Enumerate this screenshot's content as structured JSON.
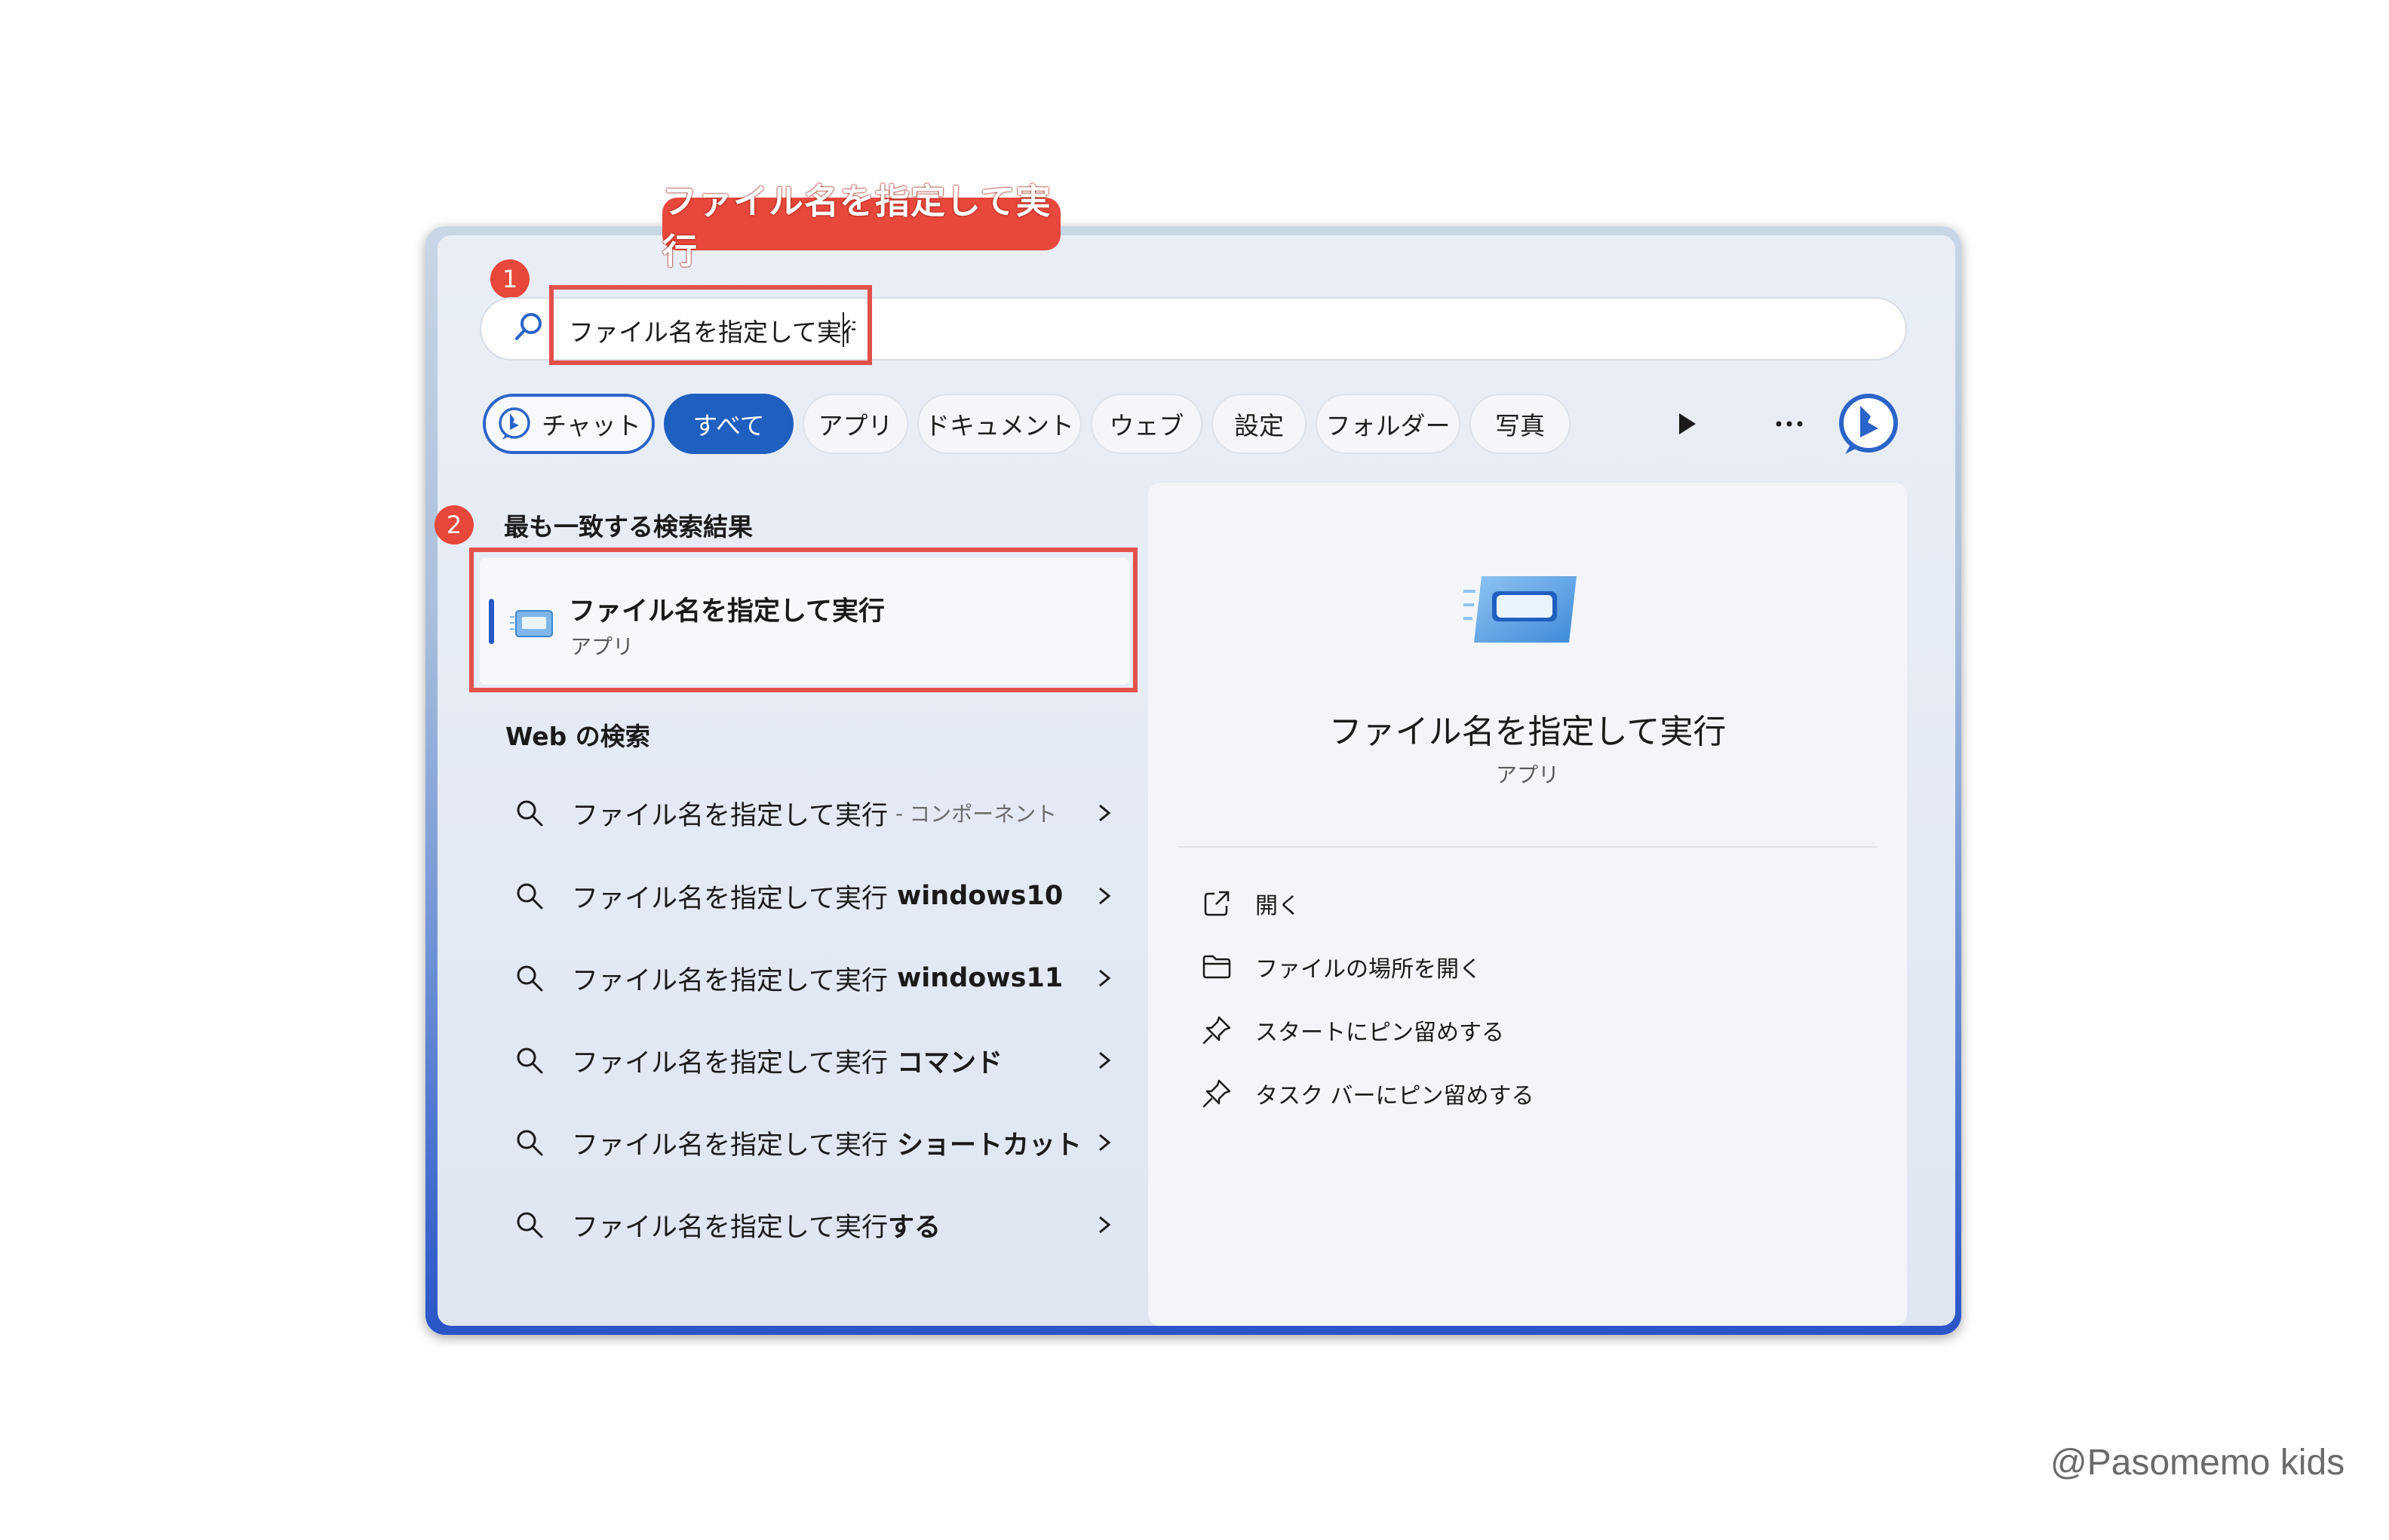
{
  "annotation": {
    "title": "ファイル名を指定して実行",
    "step1": "1",
    "step2": "2"
  },
  "search": {
    "query": "ファイル名を指定して実行"
  },
  "filters": [
    {
      "label": "チャット",
      "icon": "bing-chat-icon"
    },
    {
      "label": "すべて",
      "active": true
    },
    {
      "label": "アプリ"
    },
    {
      "label": "ドキュメント"
    },
    {
      "label": "ウェブ"
    },
    {
      "label": "設定"
    },
    {
      "label": "フォルダー"
    },
    {
      "label": "写真"
    }
  ],
  "toolbar_icons": [
    "play-more-icon",
    "more-options-icon",
    "bing-icon"
  ],
  "best_match": {
    "heading": "最も一致する検索結果",
    "title": "ファイル名を指定して実行",
    "subtitle": "アプリ"
  },
  "web_search": {
    "heading": "Web の検索",
    "items": [
      {
        "query": "ファイル名を指定して実行",
        "separator": "-",
        "suffix": "コンポーネント",
        "suffix_style": "light"
      },
      {
        "query": "ファイル名を指定して実行",
        "suffix": "windows10",
        "suffix_style": "bold"
      },
      {
        "query": "ファイル名を指定して実行",
        "suffix": "windows11",
        "suffix_style": "bold"
      },
      {
        "query": "ファイル名を指定して実行",
        "suffix": "コマンド",
        "suffix_style": "bold"
      },
      {
        "query": "ファイル名を指定して実行",
        "suffix": "ショートカット",
        "suffix_style": "bold"
      },
      {
        "query": "ファイル名を指定して実行",
        "suffix": "する",
        "suffix_style": "bold"
      }
    ]
  },
  "detail": {
    "title": "ファイル名を指定して実行",
    "subtitle": "アプリ",
    "actions": [
      {
        "label": "開く",
        "icon": "open-external-icon"
      },
      {
        "label": "ファイルの場所を開く",
        "icon": "folder-icon"
      },
      {
        "label": "スタートにピン留めする",
        "icon": "pin-icon"
      },
      {
        "label": "タスク バーにピン留めする",
        "icon": "pin-icon"
      }
    ]
  },
  "watermark": "@Pasomemo kids",
  "colors": {
    "accent": "#1f5fbf",
    "annotation_red": "#e8473b",
    "panel_bg": "#e6ecf5"
  }
}
